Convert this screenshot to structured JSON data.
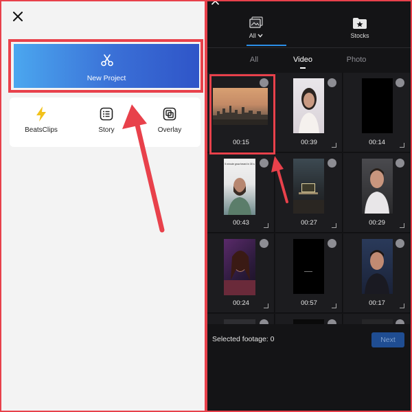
{
  "left_screen": {
    "close_icon": "close-icon",
    "new_project": {
      "label": "New Project",
      "icon": "scissors-icon"
    },
    "tools": [
      {
        "label": "BeatsClips",
        "icon": "lightning-icon",
        "color": "#f2c21b"
      },
      {
        "label": "Story",
        "icon": "list-icon"
      },
      {
        "label": "Overlay",
        "icon": "overlay-icon"
      }
    ]
  },
  "right_screen": {
    "close_icon": "close-icon",
    "categories": [
      {
        "label": "All",
        "icon": "gallery-icon",
        "active": true
      },
      {
        "label": "Stocks",
        "icon": "star-folder-icon",
        "active": false
      }
    ],
    "subtabs": [
      {
        "label": "All",
        "active": false
      },
      {
        "label": "Video",
        "active": true
      },
      {
        "label": "Photo",
        "active": false
      }
    ],
    "videos": [
      {
        "duration": "00:15",
        "kind": "cityscape"
      },
      {
        "duration": "00:39",
        "kind": "portrait-woman"
      },
      {
        "duration": "00:14",
        "kind": "black"
      },
      {
        "duration": "00:43",
        "kind": "portrait-man-caption",
        "caption": "5 minute grow beard in 30 s"
      },
      {
        "duration": "00:27",
        "kind": "laptop-desk"
      },
      {
        "duration": "00:29",
        "kind": "portrait-man-dark"
      },
      {
        "duration": "00:24",
        "kind": "portrait-woman-dark"
      },
      {
        "duration": "00:57",
        "kind": "black-text"
      },
      {
        "duration": "00:17",
        "kind": "portrait-man-blue"
      },
      {
        "duration": "",
        "kind": "partial"
      },
      {
        "duration": "",
        "kind": "partial"
      },
      {
        "duration": "",
        "kind": "partial"
      }
    ],
    "footer": {
      "selected_label": "Selected footage: 0",
      "next_label": "Next"
    }
  },
  "colors": {
    "highlight": "#e8414b",
    "accent_blue": "#2b8fe8",
    "arrow_red": "#e8414b"
  }
}
